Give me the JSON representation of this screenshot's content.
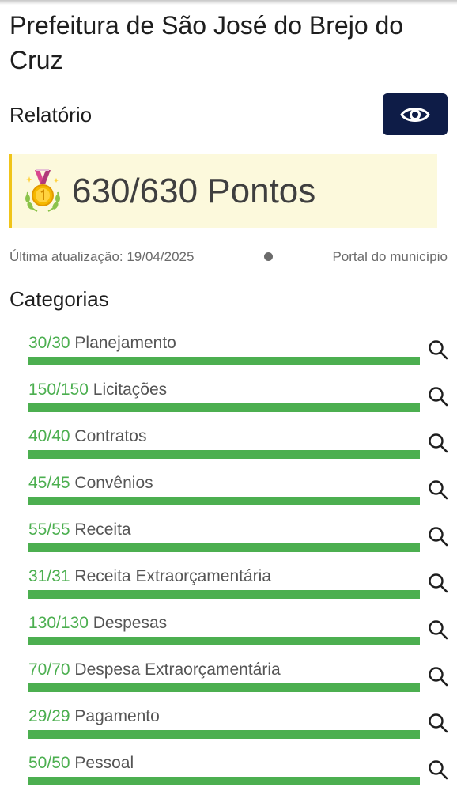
{
  "header": {
    "title": "Prefeitura de São José do Brejo do Cruz"
  },
  "report": {
    "label": "Relatório",
    "view_icon": "eye-icon",
    "button_color": "#0e1c47"
  },
  "score": {
    "text": "630/630 Pontos",
    "icon": "gold-medal-icon",
    "box_color": "#fcf9dc",
    "border_color": "#f0c419"
  },
  "meta": {
    "last_update": "Última atualização: 19/04/2025",
    "source": "Portal do município"
  },
  "categories": {
    "title": "Categorias",
    "bar_color": "#4caf50",
    "items": [
      {
        "score": "30/30",
        "name": "Planejamento",
        "value": 30,
        "max": 30
      },
      {
        "score": "150/150",
        "name": "Licitações",
        "value": 150,
        "max": 150
      },
      {
        "score": "40/40",
        "name": "Contratos",
        "value": 40,
        "max": 40
      },
      {
        "score": "45/45",
        "name": "Convênios",
        "value": 45,
        "max": 45
      },
      {
        "score": "55/55",
        "name": "Receita",
        "value": 55,
        "max": 55
      },
      {
        "score": "31/31",
        "name": "Receita Extraorçamentária",
        "value": 31,
        "max": 31
      },
      {
        "score": "130/130",
        "name": "Despesas",
        "value": 130,
        "max": 130
      },
      {
        "score": "70/70",
        "name": "Despesa Extraorçamentária",
        "value": 70,
        "max": 70
      },
      {
        "score": "29/29",
        "name": "Pagamento",
        "value": 29,
        "max": 29
      },
      {
        "score": "50/50",
        "name": "Pessoal",
        "value": 50,
        "max": 50
      }
    ]
  }
}
